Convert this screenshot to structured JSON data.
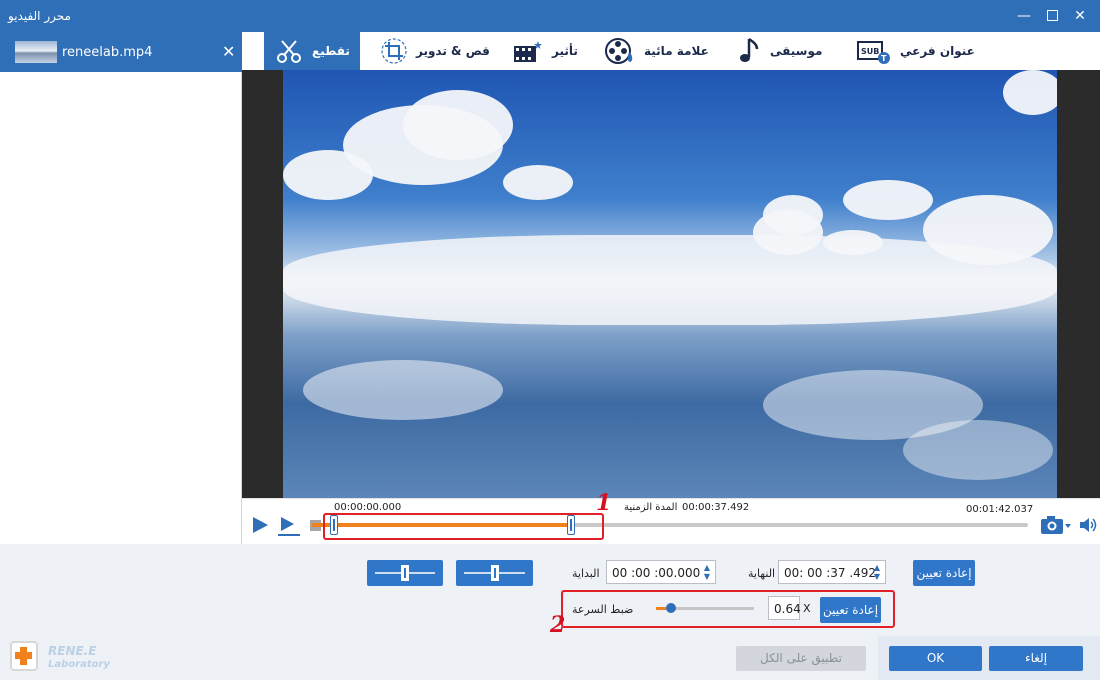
{
  "window": {
    "title": "محرر الفيديو",
    "minimize": "—",
    "close": "✕"
  },
  "file": {
    "name": "reneelab.mp4",
    "close": "✕"
  },
  "tabs": [
    {
      "label": "تقطيع",
      "icon": "scissors-icon",
      "active": true
    },
    {
      "label": "قص & تدوير",
      "icon": "crop-rotate-icon",
      "active": false
    },
    {
      "label": "تأثير",
      "icon": "film-effect-icon",
      "active": false
    },
    {
      "label": "علامة مائية",
      "icon": "film-reel-icon",
      "active": false
    },
    {
      "label": "موسيقى",
      "icon": "music-note-icon",
      "active": false
    },
    {
      "label": "عنوان فرعي",
      "icon": "subtitle-icon",
      "active": false
    }
  ],
  "timeline": {
    "start_time": "00:00:00.000",
    "duration_label": "المدة الزمنية",
    "duration_value": "00:00:37.492",
    "end_time": "00:01:42.037",
    "selection_start_fraction": 0.0,
    "selection_end_fraction": 0.367
  },
  "controls": {
    "start_label": "البداية",
    "start_value": "00 :00 :00.000",
    "end_label": "النهاية",
    "end_value": "00: 00 :37 .492",
    "reset_label": "إعادة تعيين",
    "speed_label": "ضبط السرعة",
    "speed_value": "0.64",
    "speed_unit": "X",
    "speed_reset_label": "إعادة تعيين",
    "speed_fraction": 0.1
  },
  "annotations": {
    "box1": "1",
    "box2": "2"
  },
  "footer": {
    "apply_all": "تطبيق على الكل",
    "ok": "OK",
    "cancel": "إلغاء",
    "logo_line1": "RENE.E",
    "logo_line2": "Laboratory"
  },
  "colors": {
    "accent": "#2f6fb8",
    "trim_bar": "#f0811c",
    "annotation": "#e01f26"
  }
}
